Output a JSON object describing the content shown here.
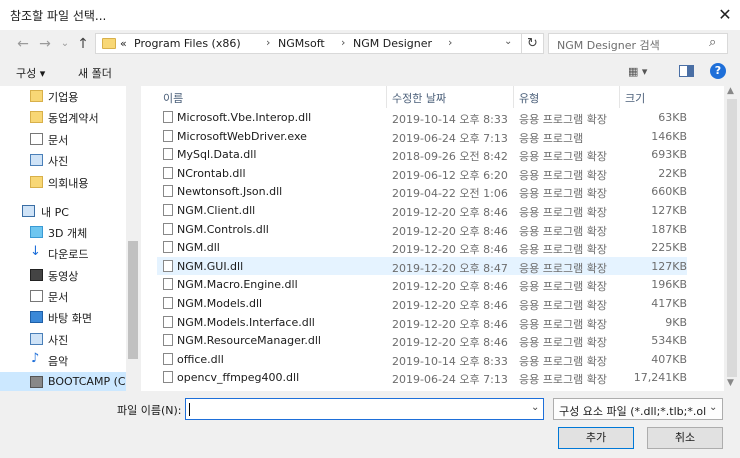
{
  "window": {
    "title": "참조할 파일 선택...",
    "close_glyph": "✕"
  },
  "nav": {
    "back": "←",
    "forward": "→",
    "recent": "⌄",
    "up": "↑",
    "breadcrumb": [
      "«",
      "Program Files (x86)",
      "NGMsoft",
      "NGM Designer"
    ],
    "crumb_sep": "›",
    "addr_dropdown": "⌄",
    "refresh": "↻",
    "search_placeholder": "NGM Designer 검색",
    "search_icon_glyph": "⌕"
  },
  "toolbar": {
    "organize": "구성 ▾",
    "new_folder": "새 폴더",
    "view_glyph": "▦ ▾",
    "help_glyph": "?"
  },
  "sidebar": {
    "items": [
      {
        "label": "기업용",
        "icon": "folder-icon"
      },
      {
        "label": "동업계약서",
        "icon": "folder-icon"
      },
      {
        "label": "문서",
        "icon": "documents-icon"
      },
      {
        "label": "사진",
        "icon": "pictures-icon"
      },
      {
        "label": "의회내용",
        "icon": "folder-icon"
      },
      {
        "label": "내 PC",
        "icon": "computer-icon"
      },
      {
        "label": "3D 개체",
        "icon": "3d-objects-icon"
      },
      {
        "label": "다운로드",
        "icon": "download-icon"
      },
      {
        "label": "동영상",
        "icon": "videos-icon"
      },
      {
        "label": "문서",
        "icon": "documents-icon"
      },
      {
        "label": "바탕 화면",
        "icon": "desktop-icon"
      },
      {
        "label": "사진",
        "icon": "pictures-icon"
      },
      {
        "label": "음악",
        "icon": "music-icon"
      },
      {
        "label": "BOOTCAMP (C:)",
        "icon": "drive-icon"
      }
    ],
    "selected": "BOOTCAMP (C:)"
  },
  "columns": {
    "name": "이름",
    "date": "수정한 날짜",
    "type": "유형",
    "size": "크기",
    "sort_glyph": "^"
  },
  "files": [
    {
      "name": "Microsoft.Vbe.Interop.dll",
      "date": "2019-10-14 오후 8:33",
      "type": "응용 프로그램 확장",
      "size": "63KB"
    },
    {
      "name": "MicrosoftWebDriver.exe",
      "date": "2019-06-24 오후 7:13",
      "type": "응용 프로그램",
      "size": "146KB"
    },
    {
      "name": "MySql.Data.dll",
      "date": "2018-09-26 오전 8:42",
      "type": "응용 프로그램 확장",
      "size": "693KB"
    },
    {
      "name": "NCrontab.dll",
      "date": "2019-06-12 오후 6:20",
      "type": "응용 프로그램 확장",
      "size": "22KB"
    },
    {
      "name": "Newtonsoft.Json.dll",
      "date": "2019-04-22 오전 1:06",
      "type": "응용 프로그램 확장",
      "size": "660KB"
    },
    {
      "name": "NGM.Client.dll",
      "date": "2019-12-20 오후 8:46",
      "type": "응용 프로그램 확장",
      "size": "127KB"
    },
    {
      "name": "NGM.Controls.dll",
      "date": "2019-12-20 오후 8:46",
      "type": "응용 프로그램 확장",
      "size": "187KB"
    },
    {
      "name": "NGM.dll",
      "date": "2019-12-20 오후 8:46",
      "type": "응용 프로그램 확장",
      "size": "225KB"
    },
    {
      "name": "NGM.GUI.dll",
      "date": "2019-12-20 오후 8:47",
      "type": "응용 프로그램 확장",
      "size": "127KB"
    },
    {
      "name": "NGM.Macro.Engine.dll",
      "date": "2019-12-20 오후 8:46",
      "type": "응용 프로그램 확장",
      "size": "196KB"
    },
    {
      "name": "NGM.Models.dll",
      "date": "2019-12-20 오후 8:46",
      "type": "응용 프로그램 확장",
      "size": "417KB"
    },
    {
      "name": "NGM.Models.Interface.dll",
      "date": "2019-12-20 오후 8:46",
      "type": "응용 프로그램 확장",
      "size": "9KB"
    },
    {
      "name": "NGM.ResourceManager.dll",
      "date": "2019-12-20 오후 8:46",
      "type": "응용 프로그램 확장",
      "size": "534KB"
    },
    {
      "name": "office.dll",
      "date": "2019-10-14 오후 8:33",
      "type": "응용 프로그램 확장",
      "size": "407KB"
    },
    {
      "name": "opencv_ffmpeg400.dll",
      "date": "2019-06-24 오후 7:13",
      "type": "응용 프로그램 확장",
      "size": "17,241KB"
    }
  ],
  "selected_file": "NGM.GUI.dll",
  "footer": {
    "filename_label": "파일 이름(N):",
    "filename_value": "",
    "filetype": "구성 요소 파일 (*.dll;*.tlb;*.olb;",
    "ok": "추가",
    "cancel": "취소",
    "dropdown_glyph": "⌄"
  },
  "scroll": {
    "up": "▲",
    "down": "▼"
  }
}
